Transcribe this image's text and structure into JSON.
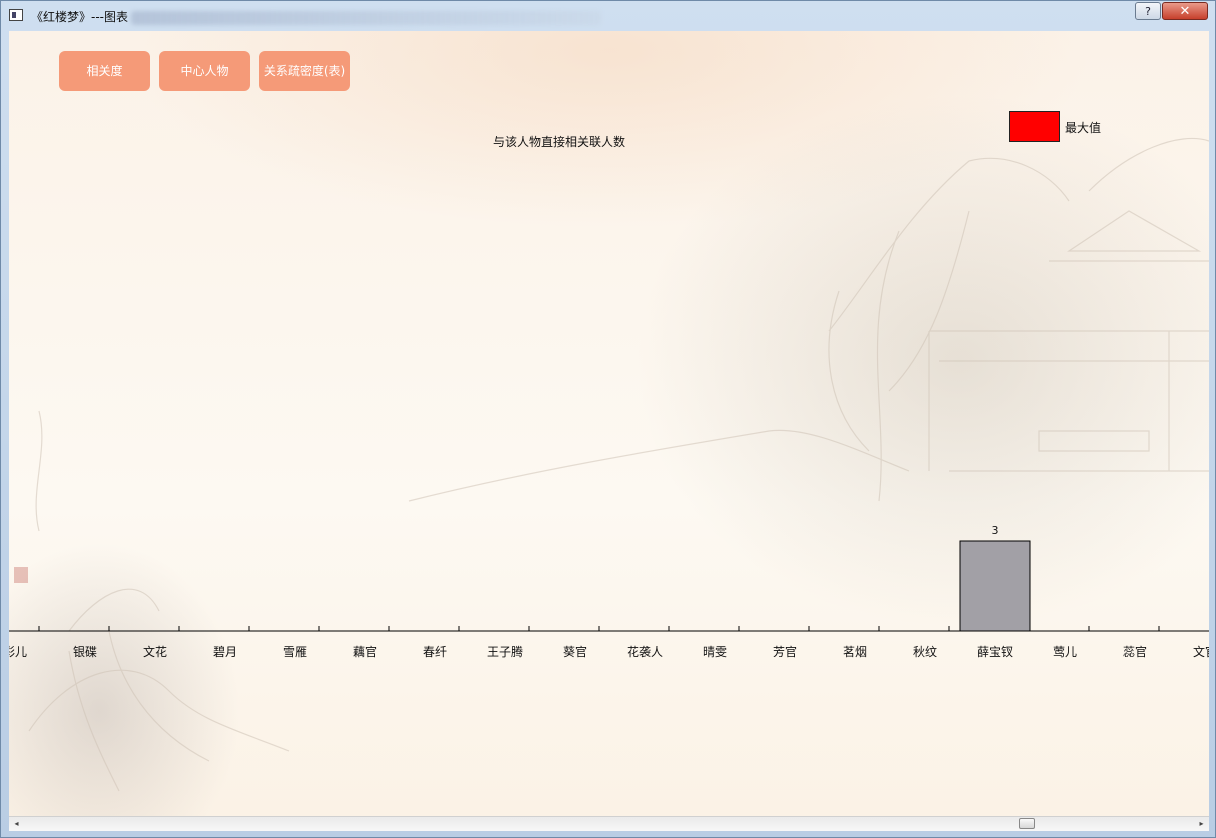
{
  "window": {
    "title": "《红楼梦》---图表",
    "help_label": "?",
    "close_label": "✕"
  },
  "tabs": [
    {
      "label": "相关度"
    },
    {
      "label": "中心人物"
    },
    {
      "label": "关系疏密度(表)"
    }
  ],
  "legend": {
    "label": "最大值",
    "color": "#ff0000"
  },
  "colors": {
    "accent": "#f59a78",
    "bar": "#a2a0a6",
    "max_bar": "#ff0000"
  },
  "scrollbar": {
    "left_arrow": "◂",
    "right_arrow": "▸"
  },
  "chart_data": {
    "type": "bar",
    "title": "与该人物直接相关联人数",
    "categories": [
      "彩儿",
      "银碟",
      "文花",
      "碧月",
      "雪雁",
      "藕官",
      "春纤",
      "王子腾",
      "葵官",
      "花袭人",
      "晴雯",
      "芳官",
      "茗烟",
      "秋纹",
      "薛宝钗",
      "莺儿",
      "蕊官",
      "文官"
    ],
    "values": [
      null,
      null,
      null,
      null,
      null,
      null,
      null,
      null,
      null,
      null,
      null,
      null,
      null,
      null,
      3,
      null,
      null,
      null
    ],
    "data_labels": [
      "",
      "",
      "",
      "",
      "",
      "",
      "",
      "",
      "",
      "",
      "",
      "",
      "",
      "",
      "3",
      "",
      "",
      ""
    ],
    "legend": [
      "最大值"
    ],
    "grid": false
  }
}
